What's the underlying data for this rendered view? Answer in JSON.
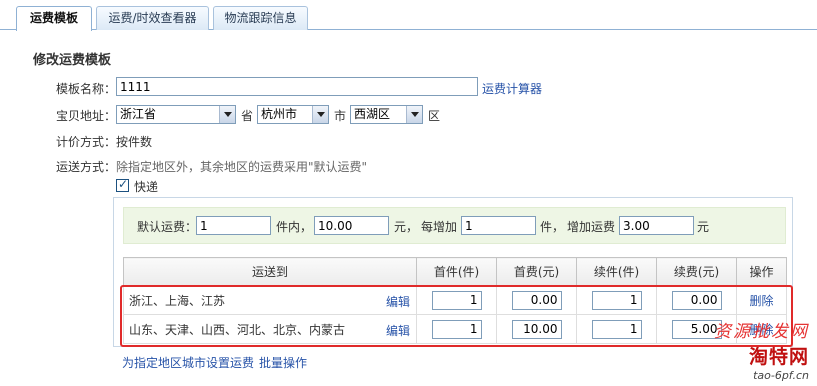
{
  "tabs": [
    {
      "label": "运费模板",
      "active": true
    },
    {
      "label": "运费/时效查看器",
      "active": false
    },
    {
      "label": "物流跟踪信息",
      "active": false
    }
  ],
  "form": {
    "title": "修改运费模板",
    "template_name_label": "模板名称：",
    "template_name_value": "1111",
    "calculator_link": "运费计算器",
    "address_label": "宝贝地址：",
    "province": "浙江省",
    "province_suffix": "省",
    "city": "杭州市",
    "city_suffix": "市",
    "district": "西湖区",
    "district_suffix": "区",
    "pricing_label": "计价方式：",
    "pricing_value": "按件数",
    "shipping_label": "运送方式：",
    "shipping_note": "除指定地区外，其余地区的运费采用\"默认运费\"",
    "express_label": "快递",
    "express_checked": true
  },
  "default_fee": {
    "label": "默认运费：",
    "first_qty": "1",
    "unit_within": "件内，",
    "first_fee": "10.00",
    "yuan": "元，",
    "each_add_label": "每增加",
    "add_qty": "1",
    "unit_piece": "件，",
    "add_fee_label": "增加运费",
    "add_fee": "3.00",
    "yuan_end": "元"
  },
  "table": {
    "headers": [
      "运送到",
      "首件(件)",
      "首费(元)",
      "续件(件)",
      "续费(元)",
      "操作"
    ],
    "edit_label": "编辑",
    "delete_label": "删除",
    "rows": [
      {
        "regions": "浙江、上海、江苏",
        "first_qty": "1",
        "first_fee": "0.00",
        "add_qty": "1",
        "add_fee": "0.00"
      },
      {
        "regions": "山东、天津、山西、河北、北京、内蒙古",
        "first_qty": "1",
        "first_fee": "10.00",
        "add_qty": "1",
        "add_fee": "5.00"
      }
    ]
  },
  "footer": {
    "set_city_link": "为指定地区城市设置运费",
    "batch_link": "批量操作"
  },
  "watermark": {
    "line1": "资源批发网",
    "line2": "淘特网",
    "line3": "tao-6pf.cn"
  },
  "colors": {
    "highlight": "#e02a2a",
    "link": "#2753a8",
    "default_box_bg": "#eef6e5"
  }
}
